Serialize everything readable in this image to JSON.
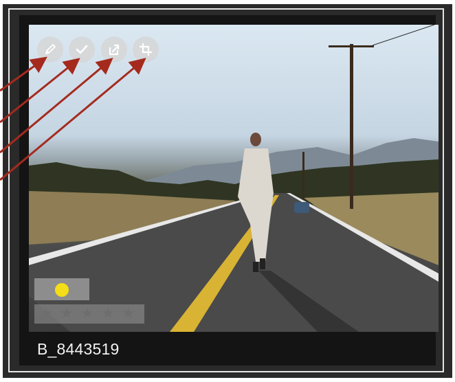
{
  "thumbnail": {
    "filename": "B_8443519",
    "color_label": "#f5dd18",
    "rating": 0,
    "max_rating": 5
  },
  "toolbar": {
    "buttons": [
      {
        "icon": "pencil-icon"
      },
      {
        "icon": "checkmark-icon"
      },
      {
        "icon": "export-icon"
      },
      {
        "icon": "crop-icon"
      }
    ]
  },
  "annotations": {
    "arrow_color": "#a52a1e"
  },
  "colors": {
    "frame": "#2a2a2a",
    "card": "#141414",
    "border": "#e6e6e6"
  }
}
